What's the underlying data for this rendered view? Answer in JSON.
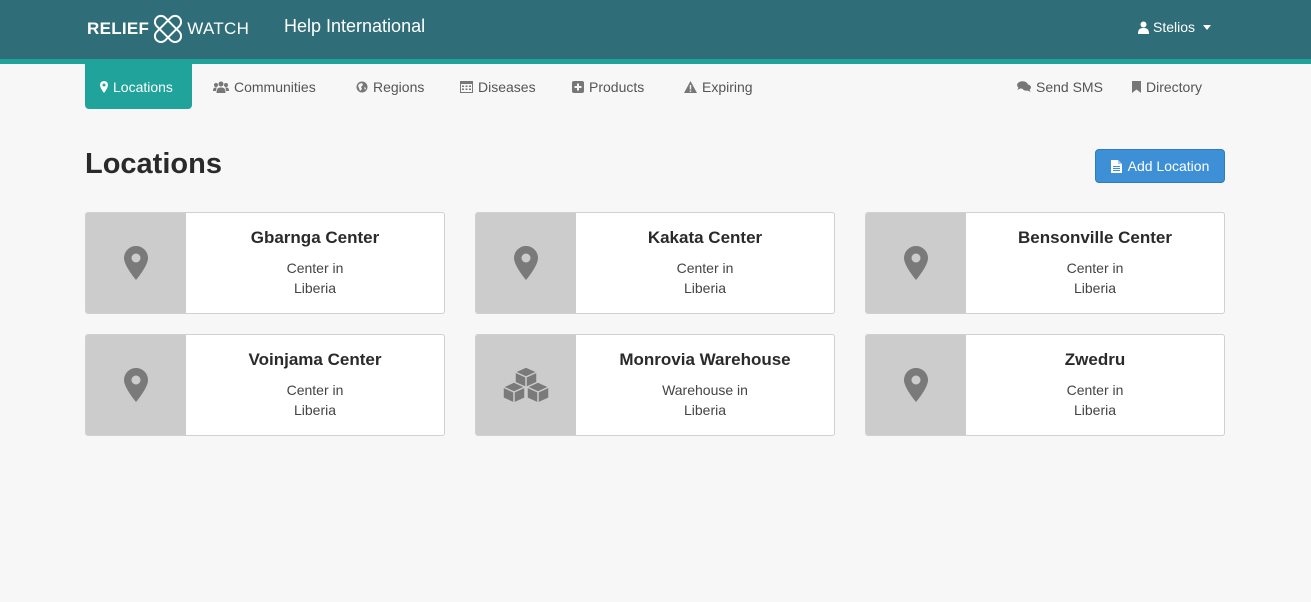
{
  "header": {
    "logo_left": "RELIEF",
    "logo_right": "WATCH",
    "org_name": "Help International",
    "user_name": "Stelios"
  },
  "nav": {
    "items": [
      {
        "label": "Locations",
        "icon": "map-marker-icon",
        "active": true
      },
      {
        "label": "Communities",
        "icon": "users-icon"
      },
      {
        "label": "Regions",
        "icon": "globe-icon"
      },
      {
        "label": "Diseases",
        "icon": "calendar-icon"
      },
      {
        "label": "Products",
        "icon": "plus-square-icon"
      },
      {
        "label": "Expiring",
        "icon": "warning-icon"
      }
    ],
    "right_items": [
      {
        "label": "Send SMS",
        "icon": "comments-icon"
      },
      {
        "label": "Directory",
        "icon": "bookmark-icon"
      }
    ]
  },
  "main": {
    "title": "Locations",
    "add_label": "Add Location",
    "cards": [
      {
        "name": "Gbarnga Center",
        "type_line": "Center in",
        "country": "Liberia",
        "icon": "map-marker-icon"
      },
      {
        "name": "Kakata Center",
        "type_line": "Center in",
        "country": "Liberia",
        "icon": "map-marker-icon"
      },
      {
        "name": "Bensonville Center",
        "type_line": "Center in",
        "country": "Liberia",
        "icon": "map-marker-icon"
      },
      {
        "name": "Voinjama Center",
        "type_line": "Center in",
        "country": "Liberia",
        "icon": "map-marker-icon"
      },
      {
        "name": "Monrovia Warehouse",
        "type_line": "Warehouse in",
        "country": "Liberia",
        "icon": "cubes-icon"
      },
      {
        "name": "Zwedru",
        "type_line": "Center in",
        "country": "Liberia",
        "icon": "map-marker-icon"
      }
    ]
  },
  "colors": {
    "header_bg": "#2f6d78",
    "accent": "#1fa39a",
    "button_blue": "#3d8fd6"
  }
}
